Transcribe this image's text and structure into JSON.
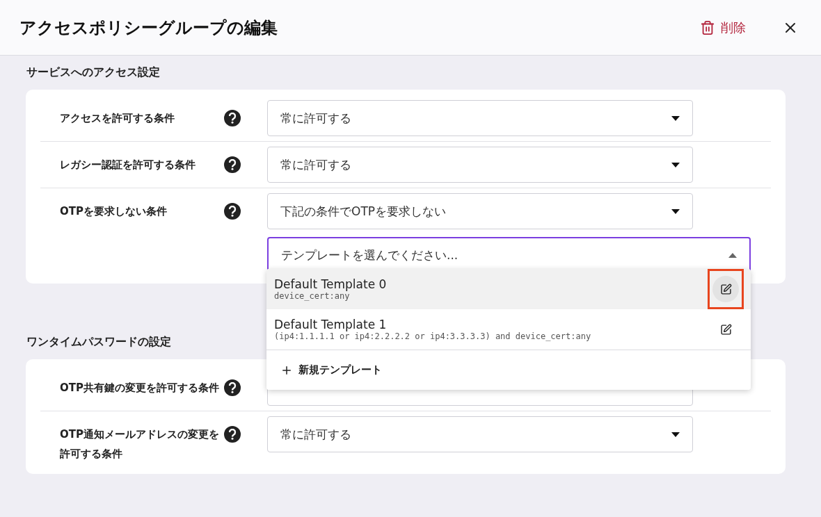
{
  "header": {
    "title": "アクセスポリシーグループの編集",
    "delete_label": "削除"
  },
  "sections": [
    {
      "title": "サービスへのアクセス設定",
      "rows": [
        {
          "label": "アクセスを許可する条件",
          "value": "常に許可する"
        },
        {
          "label": "レガシー認証を許可する条件",
          "value": "常に許可する"
        },
        {
          "label": "OTPを要求しない条件",
          "value": "下記の条件でOTPを要求しない",
          "template_picker": {
            "value": "テンプレートを選んでください...",
            "expanded": true,
            "options": [
              {
                "name": "Default Template 0",
                "condition": "device_cert:any",
                "hovered": true,
                "marked": true
              },
              {
                "name": "Default Template 1",
                "condition": "(ip4:1.1.1.1 or ip4:2.2.2.2 or ip4:3.3.3.3) and device_cert:any",
                "hovered": false,
                "marked": false
              }
            ],
            "add_label": "新規テンプレート"
          }
        }
      ]
    },
    {
      "title": "ワンタイムパスワードの設定",
      "rows": [
        {
          "label": "OTP共有鍵の変更を許可する条件"
        },
        {
          "label": "OTP通知メールアドレスの変更を許可する条件",
          "value": "常に許可する"
        }
      ]
    }
  ]
}
